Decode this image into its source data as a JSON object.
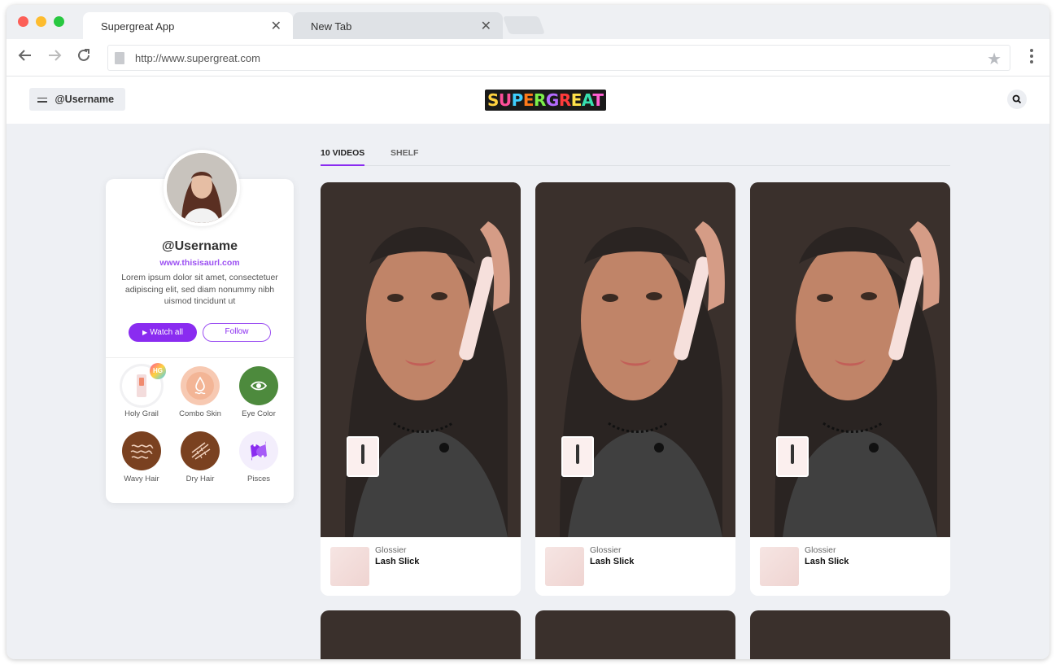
{
  "browser": {
    "tabs": [
      {
        "label": "Supergreat App",
        "active": true
      },
      {
        "label": "New Tab",
        "active": false
      }
    ],
    "url": "http://www.supergreat.com"
  },
  "header": {
    "username_pill": "@Username",
    "logo_text": "SUPERGREAT"
  },
  "profile": {
    "name": "@Username",
    "url": "www.thisisaurl.com",
    "bio": "Lorem ipsum dolor sit amet, consectetuer adipiscing elit, sed diam nonummy nibh uismod tincidunt ut",
    "watch_label": "Watch all",
    "follow_label": "Follow",
    "badge_hg": "HG",
    "traits": [
      {
        "label": "Holy Grail",
        "icon": "holy-grail-icon"
      },
      {
        "label": "Combo Skin",
        "icon": "combo-skin-icon"
      },
      {
        "label": "Eye Color",
        "icon": "eye-icon"
      },
      {
        "label": "Wavy Hair",
        "icon": "wavy-hair-icon"
      },
      {
        "label": "Dry Hair",
        "icon": "dry-hair-icon"
      },
      {
        "label": "Pisces",
        "icon": "pisces-icon"
      }
    ]
  },
  "content_tabs": [
    {
      "label": "10 VIDEOS",
      "active": true
    },
    {
      "label": "SHELF",
      "active": false
    }
  ],
  "videos": [
    {
      "brand": "Glossier",
      "product": "Lash Slick"
    },
    {
      "brand": "Glossier",
      "product": "Lash Slick"
    },
    {
      "brand": "Glossier",
      "product": "Lash Slick"
    }
  ],
  "colors": {
    "accent": "#8a2cf0",
    "link": "#9b4ff2"
  }
}
